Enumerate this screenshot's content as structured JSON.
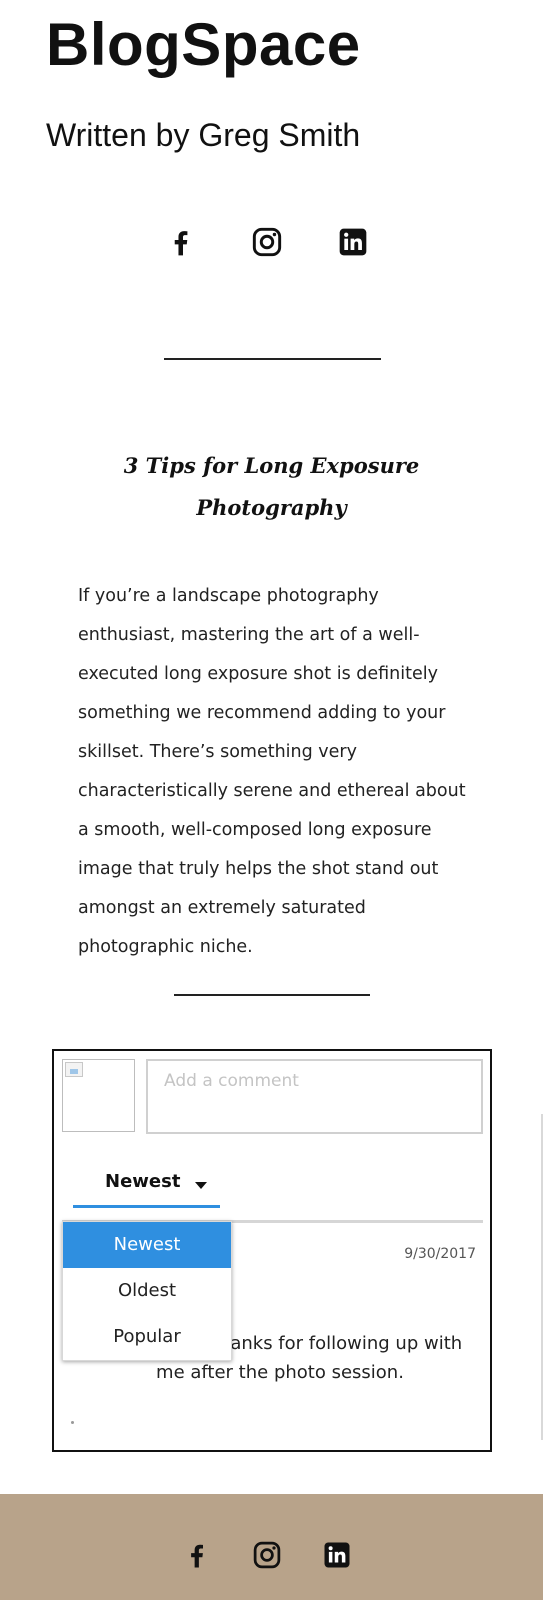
{
  "site": {
    "title": "BlogSpace",
    "author_line": "Written by Greg Smith"
  },
  "social": {
    "icons": [
      "facebook-icon",
      "instagram-icon",
      "linkedin-icon"
    ]
  },
  "post": {
    "title_line1": "3 Tips for Long Exposure",
    "title_line2": "Photography",
    "body": "If you’re a landscape photography enthusiast, mastering the art of a well-executed long exposure shot is definitely something we recommend adding to your skillset. There’s something very characteristically serene and ethereal about a smooth, well-composed long exposure image that truly helps the shot stand out amongst an extremely saturated photographic niche."
  },
  "comments": {
    "input_placeholder": "Add a comment",
    "sort_selected": "Newest",
    "sort_options": [
      "Newest",
      "Oldest",
      "Popular"
    ],
    "items": [
      {
        "date": "9/30/2017",
        "text_visible": "ntent Greg! Thanks for following up with me after the photo session."
      }
    ]
  },
  "colors": {
    "footer_bg": "#b8a38a",
    "accent_blue": "#2f8fe0"
  }
}
